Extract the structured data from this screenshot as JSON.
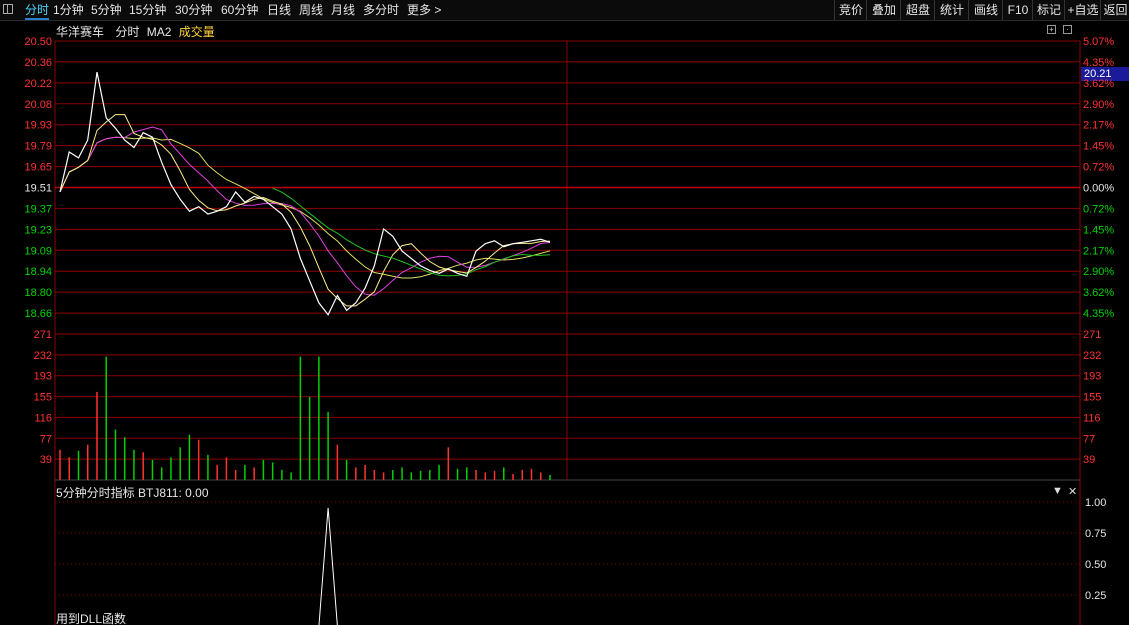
{
  "toolbar": {
    "timeframes": [
      {
        "label": "分时",
        "active": true
      },
      {
        "label": "1分钟"
      },
      {
        "label": "5分钟"
      },
      {
        "label": "15分钟"
      },
      {
        "label": "30分钟"
      },
      {
        "label": "60分钟"
      },
      {
        "label": "日线"
      },
      {
        "label": "周线"
      },
      {
        "label": "月线"
      },
      {
        "label": "多分时"
      },
      {
        "label": "更多 >"
      }
    ],
    "right_buttons": [
      "竞价",
      "叠加",
      "超盘",
      "统计",
      "画线",
      "F10",
      "标记",
      "+自选",
      "返回"
    ]
  },
  "chart": {
    "stock_name": "华洋赛车",
    "mode": "分时",
    "ma_label": "MA2",
    "volume_label": "成交量",
    "current_price_badge": "20.21",
    "price_ticks_left": [
      "20.50",
      "20.36",
      "20.22",
      "20.08",
      "19.93",
      "19.79",
      "19.65",
      "19.51",
      "19.37",
      "19.23",
      "19.09",
      "18.94",
      "18.80",
      "18.66"
    ],
    "pct_ticks_right": [
      "5.07%",
      "4.35%",
      "3.62%",
      "2.90%",
      "2.17%",
      "1.45%",
      "0.72%",
      "0.00%",
      "0.72%",
      "1.45%",
      "2.17%",
      "2.90%",
      "3.62%",
      "4.35%"
    ],
    "volume_ticks": [
      "271",
      "232",
      "193",
      "155",
      "116",
      "77",
      "39"
    ],
    "indicator_title": "5分钟分时指标  BTJ811: 0.00",
    "indicator_ticks": [
      "1.00",
      "0.75",
      "0.50",
      "0.25"
    ],
    "dll_note": "用到DLL函数",
    "colors": {
      "up": "#ff3232",
      "down": "#00d200",
      "grid": "#8b0000",
      "price_line": "#ffffff",
      "ma_yellow": "#e0e060",
      "ma_magenta": "#e040e0",
      "ma_green": "#20c020",
      "avg_line": "#ffff80"
    }
  },
  "chart_data": {
    "type": "line",
    "title": "",
    "ylim": [
      18.59,
      20.57
    ],
    "series": [
      {
        "name": "",
        "values": [
          19.55,
          19.82,
          19.78,
          19.9,
          20.36,
          20.05,
          19.98,
          19.9,
          19.85,
          19.95,
          19.92,
          19.75,
          19.6,
          19.5,
          19.42,
          19.45,
          19.4,
          19.42,
          19.45,
          19.55,
          19.48,
          19.52,
          19.5,
          19.45,
          19.4,
          19.3,
          19.1,
          18.95,
          18.8,
          18.72,
          18.85,
          18.75,
          18.8,
          18.9,
          19.05,
          19.3,
          19.25,
          19.15,
          19.1,
          19.05,
          19.02,
          19.0,
          19.03,
          19.0,
          18.98,
          19.15,
          19.2,
          19.22,
          19.18,
          19.2,
          19.21,
          19.22,
          19.23,
          19.21
        ]
      }
    ],
    "volume": [
      60,
      45,
      58,
      70,
      175,
      245,
      100,
      85,
      60,
      55,
      40,
      25,
      45,
      65,
      90,
      80,
      50,
      30,
      45,
      20,
      30,
      25,
      40,
      35,
      20,
      15,
      245,
      165,
      245,
      135,
      70,
      40,
      25,
      30,
      20,
      15,
      20,
      25,
      15,
      18,
      20,
      30,
      65,
      22,
      25,
      20,
      15,
      18,
      25,
      12,
      20,
      22,
      15,
      10
    ],
    "volume_ylim": [
      0,
      290
    ],
    "indicator": [
      0,
      0,
      0,
      0,
      0,
      0,
      0,
      0,
      0,
      0,
      0,
      0,
      0,
      0,
      0,
      0,
      0,
      0,
      0,
      0,
      0,
      0,
      0,
      0,
      0,
      0,
      0,
      0,
      0,
      1,
      0,
      0,
      0,
      0,
      0,
      0,
      0,
      0,
      0,
      0,
      0,
      0,
      0,
      0,
      0,
      0,
      0,
      0,
      0,
      0,
      0,
      0,
      0,
      0
    ],
    "indicator_ylim": [
      0,
      1.05
    ]
  }
}
